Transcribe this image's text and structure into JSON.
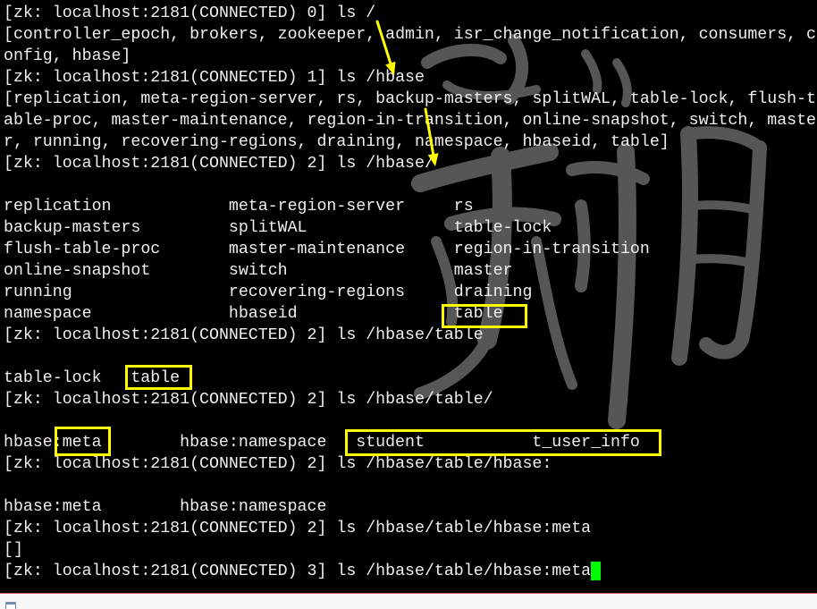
{
  "theme": {
    "background": "#000000",
    "foreground": "#f0f0f0",
    "cursor": "#00ff00",
    "annotation": "#ffff00"
  },
  "icons": {
    "status_bar_icon": "window-icon"
  },
  "session": {
    "commands": [
      {
        "prompt": "[zk: localhost:2181(CONNECTED) 0]",
        "command": "ls /"
      },
      {
        "prompt": "[zk: localhost:2181(CONNECTED) 1]",
        "command": "ls /hbase"
      },
      {
        "prompt": "[zk: localhost:2181(CONNECTED) 2]",
        "command": "ls /hbase/"
      },
      {
        "prompt": "[zk: localhost:2181(CONNECTED) 2]",
        "command": "ls /hbase/table"
      },
      {
        "prompt": "[zk: localhost:2181(CONNECTED) 2]",
        "command": "ls /hbase/table/"
      },
      {
        "prompt": "[zk: localhost:2181(CONNECTED) 2]",
        "command": "ls /hbase/table/hbase:"
      },
      {
        "prompt": "[zk: localhost:2181(CONNECTED) 2]",
        "command": "ls /hbase/table/hbase:meta"
      },
      {
        "prompt": "[zk: localhost:2181(CONNECTED) 3]",
        "command": "ls /hbase/table/hbase:meta"
      }
    ],
    "root_ls_output": [
      "[controller_epoch, brokers, zookeeper, admin, isr_change_notification, consumers, c",
      "onfig, hbase]"
    ],
    "hbase_ls_output": [
      "[replication, meta-region-server, rs, backup-masters, splitWAL, table-lock, flush-t",
      "able-proc, master-maintenance, region-in-transition, online-snapshot, switch, maste",
      "r, running, recovering-regions, draining, namespace, hbaseid, table]"
    ],
    "hbase_dir_listing": [
      [
        "replication",
        "meta-region-server",
        "rs"
      ],
      [
        "backup-masters",
        "splitWAL",
        "table-lock"
      ],
      [
        "flush-table-proc",
        "master-maintenance",
        "region-in-transition"
      ],
      [
        "online-snapshot",
        "switch",
        "master"
      ],
      [
        "running",
        "recovering-regions",
        "draining"
      ],
      [
        "namespace",
        "hbaseid",
        "table"
      ]
    ],
    "table_listing": [
      "table-lock",
      "table"
    ],
    "table_dir_listing": [
      "hbase:meta",
      "hbase:namespace",
      "student",
      "t_user_info"
    ],
    "hbase_namespace_listing": [
      "hbase:meta",
      "hbase:namespace"
    ],
    "meta_output": "[]"
  }
}
